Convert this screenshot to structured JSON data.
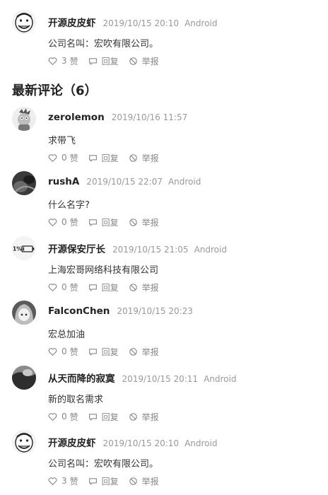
{
  "section": {
    "title": "最新评论（6）"
  },
  "action_labels": {
    "like": "赞",
    "reply": "回复",
    "report": "举报"
  },
  "pinned": {
    "author": "开源皮皮虾",
    "time": "2019/10/15 20:10",
    "device": "Android",
    "text": "公司名叫：宏吹有限公司。",
    "likes": "3",
    "avatar": "meme-face-avatar"
  },
  "comments": [
    {
      "author": "zerolemon",
      "time": "2019/10/16 11:57",
      "device": "",
      "text": "求带飞",
      "likes": "0",
      "avatar": "cartoon-character-avatar"
    },
    {
      "author": "rushA",
      "time": "2019/10/15 22:07",
      "device": "Android",
      "text": "什么名字?",
      "likes": "0",
      "avatar": "dark-photo-avatar"
    },
    {
      "author": "开源保安厅长",
      "time": "2019/10/15 21:05",
      "device": "Android",
      "text": "上海宏哥网络科技有限公司",
      "likes": "0",
      "avatar": "battery-avatar",
      "avatar_text": "1%"
    },
    {
      "author": "FalconChen",
      "time": "2019/10/15 20:23",
      "device": "",
      "text": "宏总加油",
      "likes": "0",
      "avatar": "anime-girl-avatar"
    },
    {
      "author": "从天而降的寂寞",
      "time": "2019/10/15 20:11",
      "device": "Android",
      "text": "新的取名需求",
      "likes": "0",
      "avatar": "grayscale-photo-avatar"
    },
    {
      "author": "开源皮皮虾",
      "time": "2019/10/15 20:10",
      "device": "Android",
      "text": "公司名叫：宏吹有限公司。",
      "likes": "3",
      "avatar": "meme-face-avatar"
    }
  ]
}
